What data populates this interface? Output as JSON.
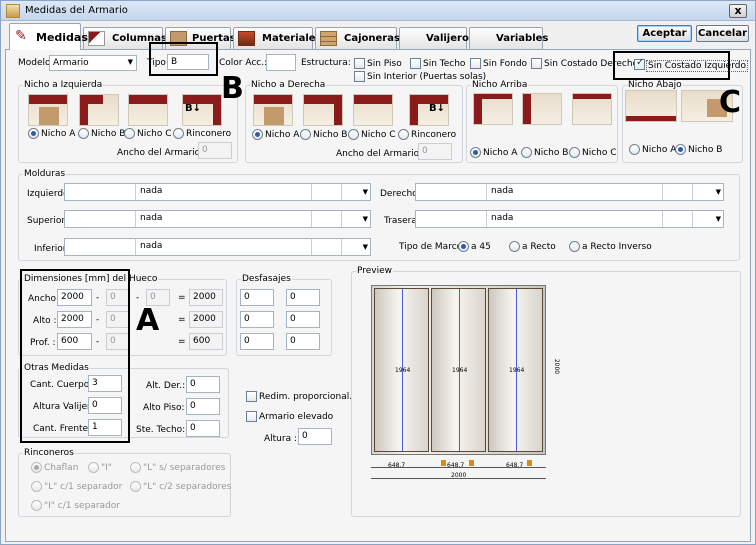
{
  "window": {
    "title": "Medidas del Armario",
    "close": "x"
  },
  "tabs": [
    {
      "label": "Medidas"
    },
    {
      "label": "Columnas"
    },
    {
      "label": "Puertas"
    },
    {
      "label": "Materiales"
    },
    {
      "label": "Cajoneras"
    },
    {
      "label": "Valijero"
    },
    {
      "label": "Variables"
    }
  ],
  "buttons": {
    "accept": "Aceptar",
    "cancel": "Cancelar"
  },
  "top": {
    "modelo_label": "Modelo:",
    "modelo_value": "Armario",
    "tipo_label": "Tipo:",
    "tipo_value": "B",
    "color_label": "Color Acc.:",
    "color_value": "",
    "estructura_label": "Estructura:"
  },
  "estructura": [
    "Sin Piso",
    "Sin Techo",
    "Sin Fondo",
    "Sin Costado Derecho",
    "Sin Costado Izquierdo",
    "Sin Interior (Puertas solas)"
  ],
  "nicho_izq": {
    "title": "Nicho a Izquierda",
    "options": [
      "Nicho A",
      "Nicho B",
      "Nicho C",
      "Rinconero"
    ],
    "ancho_label": "Ancho del Armario B :",
    "ancho_value": "0"
  },
  "nicho_der": {
    "title": "Nicho a Derecha",
    "options": [
      "Nicho A",
      "Nicho B",
      "Nicho C",
      "Rinconero"
    ],
    "ancho_label": "Ancho del Armario B :",
    "ancho_value": "0"
  },
  "nicho_arr": {
    "title": "Nicho Arriba",
    "options": [
      "Nicho A",
      "Nicho B",
      "Nicho C"
    ]
  },
  "nicho_aba": {
    "title": "Nicho Abajo",
    "options": [
      "Nicho A",
      "Nicho B"
    ]
  },
  "molduras": {
    "title": "Molduras",
    "izquierdo": "Izquierdo:",
    "superior": "Superior :",
    "inferior": "Inferior:",
    "derecho": "Derecho:",
    "trasera": "Trasera:",
    "value": "nada",
    "marco_label": "Tipo de Marco:",
    "marco": [
      "a 45",
      "a Recto",
      "a Recto Inverso"
    ]
  },
  "dimensiones": {
    "title": "Dimensiones [mm] del Hueco",
    "ancho": "Ancho:",
    "alto": "Alto :",
    "prof": "Prof. :",
    "ancho_v": "2000",
    "alto_v": "2000",
    "prof_v": "600",
    "z": "0",
    "res_ancho": "2000",
    "res_alto": "2000",
    "res_prof": "600",
    "dash": "-",
    "eq": "="
  },
  "desfasajes": {
    "title": "Desfasajes",
    "v": "0"
  },
  "otras": {
    "title": "Otras Medidas",
    "cuerpos_l": "Cant. Cuerpos :",
    "cuerpos": "3",
    "valijero_l": "Altura Valijero :",
    "valijero": "0",
    "frentes_l": "Cant. Frentes :",
    "frentes": "1",
    "altder_l": "Alt. Der.:",
    "altder": "0",
    "altpiso_l": "Alto Piso:",
    "altpiso": "0",
    "stetecho_l": "Ste. Techo:",
    "stetecho": "0"
  },
  "extra": {
    "redim": "Redim. proporcional.",
    "elevado": "Armario elevado",
    "altura_l": "Altura :",
    "altura": "0"
  },
  "rinconeros": {
    "title": "Rinconeros",
    "opts": [
      "Chaflan",
      "\"I\"",
      "\"L\" s/ separadores",
      "\"L\" c/1 separador",
      "\"L\" c/2 separadores",
      "\"I\" c/1 separador"
    ]
  },
  "preview": {
    "title": "Preview",
    "door_label": "1964",
    "width_label": "2000",
    "height_label": "2000",
    "seg": "648.7"
  },
  "markers": {
    "a": "A",
    "b": "B",
    "c": "C"
  },
  "colors": {
    "dark_red": "#8b1a1a",
    "wood": "#c29a6b",
    "accent": "#2a5fa8"
  }
}
